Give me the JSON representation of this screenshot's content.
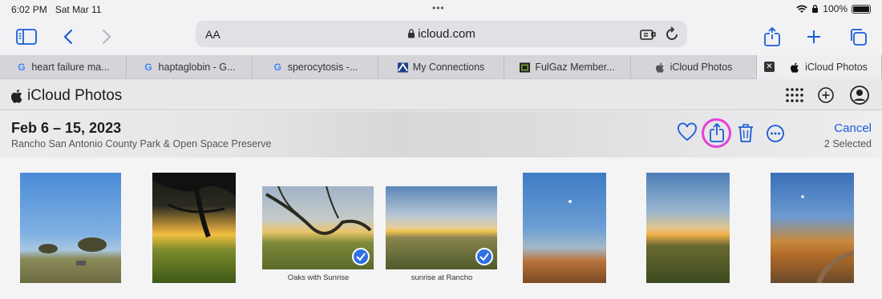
{
  "status": {
    "time": "6:02 PM",
    "date": "Sat Mar 11",
    "battery": "100%",
    "dots": "•••"
  },
  "browser": {
    "url": "icloud.com",
    "text_size_label": "AA"
  },
  "tabs": [
    {
      "label": "heart failure ma...",
      "favicon": "google-icon"
    },
    {
      "label": "haptaglobin - G...",
      "favicon": "google-icon"
    },
    {
      "label": "sperocytosis -...",
      "favicon": "google-icon"
    },
    {
      "label": "My Connections",
      "favicon": "connections-icon"
    },
    {
      "label": "FulGaz Member...",
      "favicon": "fulgaz-icon"
    },
    {
      "label": "iCloud Photos",
      "favicon": "apple-icon"
    },
    {
      "label": "iCloud Photos",
      "favicon": "apple-icon",
      "active": true
    }
  ],
  "app": {
    "title": "iCloud Photos"
  },
  "selection": {
    "title": "Feb 6 – 15, 2023",
    "location": "Rancho San Antonio County Park & Open Space Preserve",
    "cancel_label": "Cancel",
    "selected_label": "2 Selected",
    "highlight_color": "#e83fd7"
  },
  "photos": [
    {
      "caption": "",
      "selected": false
    },
    {
      "caption": "",
      "selected": false
    },
    {
      "caption": "Oaks with Sunrise",
      "selected": true
    },
    {
      "caption": "sunrise at Rancho",
      "selected": true
    },
    {
      "caption": "",
      "selected": false
    },
    {
      "caption": "",
      "selected": false
    },
    {
      "caption": "",
      "selected": false
    }
  ],
  "colors": {
    "accent": "#1a5cd8",
    "check": "#2f6fe2"
  }
}
